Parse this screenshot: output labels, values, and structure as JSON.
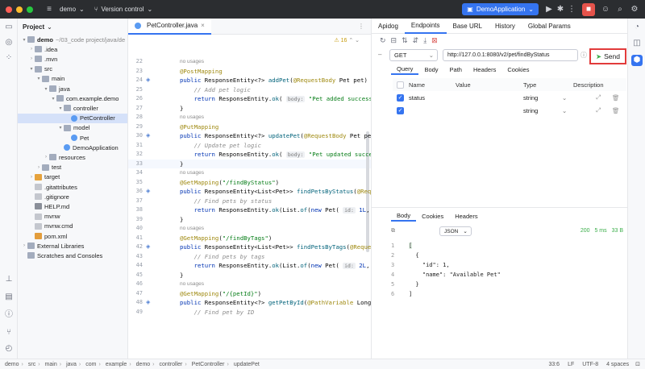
{
  "titlebar": {
    "project": "demo",
    "vcs": "Version control",
    "run_config": "DemoApplication"
  },
  "project_panel": {
    "title": "Project",
    "rows": [
      {
        "label": "demo",
        "suffix": "~/03_code project/java/de",
        "indent": 0,
        "type": "folder",
        "arrow": "▾"
      },
      {
        "label": ".idea",
        "indent": 1,
        "type": "folder",
        "arrow": "›"
      },
      {
        "label": ".mvn",
        "indent": 1,
        "type": "folder",
        "arrow": "›"
      },
      {
        "label": "src",
        "indent": 1,
        "type": "folder",
        "arrow": "▾"
      },
      {
        "label": "main",
        "indent": 2,
        "type": "folder",
        "arrow": "▾"
      },
      {
        "label": "java",
        "indent": 3,
        "type": "folder",
        "arrow": "▾"
      },
      {
        "label": "com.example.demo",
        "indent": 4,
        "type": "folder",
        "arrow": "▾"
      },
      {
        "label": "controller",
        "indent": 5,
        "type": "folder",
        "arrow": "▾"
      },
      {
        "label": "PetController",
        "indent": 6,
        "type": "java",
        "arrow": "",
        "selected": true
      },
      {
        "label": "model",
        "indent": 5,
        "type": "folder",
        "arrow": "▾"
      },
      {
        "label": "Pet",
        "indent": 6,
        "type": "java",
        "arrow": ""
      },
      {
        "label": "DemoApplication",
        "indent": 5,
        "type": "java",
        "arrow": ""
      },
      {
        "label": "resources",
        "indent": 3,
        "type": "folder",
        "arrow": "›"
      },
      {
        "label": "test",
        "indent": 2,
        "type": "folder",
        "arrow": "›"
      },
      {
        "label": "target",
        "indent": 1,
        "type": "folderorange",
        "arrow": "›"
      },
      {
        "label": ".gitattributes",
        "indent": 1,
        "type": "file",
        "arrow": ""
      },
      {
        "label": ".gitignore",
        "indent": 1,
        "type": "file",
        "arrow": ""
      },
      {
        "label": "HELP.md",
        "indent": 1,
        "type": "md",
        "arrow": ""
      },
      {
        "label": "mvnw",
        "indent": 1,
        "type": "file",
        "arrow": ""
      },
      {
        "label": "mvnw.cmd",
        "indent": 1,
        "type": "file",
        "arrow": ""
      },
      {
        "label": "pom.xml",
        "indent": 1,
        "type": "xml",
        "arrow": ""
      },
      {
        "label": "External Libraries",
        "indent": 0,
        "type": "lib",
        "arrow": "›"
      },
      {
        "label": "Scratches and Consoles",
        "indent": 0,
        "type": "lib",
        "arrow": ""
      }
    ]
  },
  "editor": {
    "tab": "PetController.java",
    "warnings": "⚠ 16",
    "lines": [
      {
        "n": "22",
        "html": "",
        "usage": "no usages"
      },
      {
        "n": "23",
        "parts": [
          [
            "an",
            "@PostMapping"
          ]
        ]
      },
      {
        "n": "24",
        "parts": [
          [
            "kw",
            "public "
          ],
          [
            "",
            "ResponseEntity<?> "
          ],
          [
            "fn",
            "addPet"
          ],
          [
            "",
            "("
          ],
          [
            "an",
            "@RequestBody "
          ],
          [
            "",
            "Pet pet) {"
          ]
        ],
        "mark": true
      },
      {
        "n": "25",
        "parts": [
          [
            "cm",
            "    // Add pet logic"
          ]
        ]
      },
      {
        "n": "26",
        "parts": [
          [
            "kw",
            "    return "
          ],
          [
            "",
            "ResponseEntity."
          ],
          [
            "fn",
            "ok"
          ],
          [
            "",
            "( "
          ],
          [
            "hint",
            "body:"
          ],
          [
            "st",
            " \"Pet added successfull"
          ]
        ]
      },
      {
        "n": "27",
        "parts": [
          [
            "",
            "}"
          ]
        ]
      },
      {
        "n": "28",
        "parts": [],
        "usage": "no usages"
      },
      {
        "n": "29",
        "parts": [
          [
            "an",
            "@PutMapping"
          ]
        ]
      },
      {
        "n": "30",
        "parts": [
          [
            "kw",
            "public "
          ],
          [
            "",
            "ResponseEntity<?> "
          ],
          [
            "fn",
            "updatePet"
          ],
          [
            "",
            "("
          ],
          [
            "an",
            "@RequestBody "
          ],
          [
            "",
            "Pet pet) {"
          ]
        ],
        "mark": true
      },
      {
        "n": "31",
        "parts": [
          [
            "cm",
            "    // Update pet logic"
          ]
        ]
      },
      {
        "n": "32",
        "parts": [
          [
            "kw",
            "    return "
          ],
          [
            "",
            "ResponseEntity."
          ],
          [
            "fn",
            "ok"
          ],
          [
            "",
            "( "
          ],
          [
            "hint",
            "body:"
          ],
          [
            "st",
            " \"Pet updated successfu"
          ]
        ]
      },
      {
        "n": "33",
        "parts": [
          [
            "",
            "}"
          ]
        ]
      },
      {
        "n": "34",
        "parts": [],
        "usage": "no usages"
      },
      {
        "n": "35",
        "parts": [
          [
            "an",
            "@GetMapping"
          ],
          [
            "",
            "("
          ],
          [
            "st",
            "\"/findByStatus\""
          ],
          [
            "",
            ")"
          ]
        ]
      },
      {
        "n": "36",
        "parts": [
          [
            "kw",
            "public "
          ],
          [
            "",
            "ResponseEntity<List<Pet>> "
          ],
          [
            "fn",
            "findPetsByStatus"
          ],
          [
            "",
            "("
          ],
          [
            "an",
            "@Reque"
          ]
        ],
        "mark": true
      },
      {
        "n": "37",
        "parts": [
          [
            "cm",
            "    // Find pets by status"
          ]
        ]
      },
      {
        "n": "38",
        "parts": [
          [
            "kw",
            "    return "
          ],
          [
            "",
            "ResponseEntity."
          ],
          [
            "fn",
            "ok"
          ],
          [
            "",
            "(List."
          ],
          [
            "fn",
            "of"
          ],
          [
            "",
            "("
          ],
          [
            "kw",
            "new "
          ],
          [
            "",
            "Pet( "
          ],
          [
            "hint",
            "id:"
          ],
          [
            "kw",
            " 1L"
          ],
          [
            "",
            ",  "
          ],
          [
            "hint",
            "nam"
          ]
        ]
      },
      {
        "n": "39",
        "parts": [
          [
            "",
            "}"
          ]
        ]
      },
      {
        "n": "40",
        "parts": [],
        "usage": "no usages"
      },
      {
        "n": "41",
        "parts": [
          [
            "an",
            "@GetMapping"
          ],
          [
            "",
            "("
          ],
          [
            "st",
            "\"/findByTags\""
          ],
          [
            "",
            ")"
          ]
        ]
      },
      {
        "n": "42",
        "parts": [
          [
            "kw",
            "public "
          ],
          [
            "",
            "ResponseEntity<List<Pet>> "
          ],
          [
            "fn",
            "findPetsByTags"
          ],
          [
            "",
            "("
          ],
          [
            "an",
            "@Requestl"
          ]
        ],
        "mark": true
      },
      {
        "n": "43",
        "parts": [
          [
            "cm",
            "    // Find pets by tags"
          ]
        ]
      },
      {
        "n": "44",
        "parts": [
          [
            "kw",
            "    return "
          ],
          [
            "",
            "ResponseEntity."
          ],
          [
            "fn",
            "ok"
          ],
          [
            "",
            "(List."
          ],
          [
            "fn",
            "of"
          ],
          [
            "",
            "("
          ],
          [
            "kw",
            "new "
          ],
          [
            "",
            "Pet( "
          ],
          [
            "hint",
            "id:"
          ],
          [
            "kw",
            " 2L"
          ],
          [
            "",
            ",  "
          ],
          [
            "hint",
            "nam"
          ]
        ]
      },
      {
        "n": "45",
        "parts": [
          [
            "",
            "}"
          ]
        ]
      },
      {
        "n": "46",
        "parts": [],
        "usage": "no usages"
      },
      {
        "n": "47",
        "parts": [
          [
            "an",
            "@GetMapping"
          ],
          [
            "",
            "("
          ],
          [
            "st",
            "\"/{petId}\""
          ],
          [
            "",
            ")"
          ]
        ]
      },
      {
        "n": "48",
        "parts": [
          [
            "kw",
            "public "
          ],
          [
            "",
            "ResponseEntity<?> "
          ],
          [
            "fn",
            "getPetById"
          ],
          [
            "",
            "("
          ],
          [
            "an",
            "@PathVariable "
          ],
          [
            "",
            "Long p"
          ]
        ],
        "mark": true
      },
      {
        "n": "49",
        "parts": [
          [
            "cm",
            "    // Find pet by ID"
          ]
        ]
      }
    ]
  },
  "apidog": {
    "tabs": [
      "Apidog",
      "Endpoints",
      "Base URL",
      "History",
      "Global Params"
    ],
    "active_tab": "Endpoints",
    "method": "GET",
    "url": "http://127.0.0.1:8080/v2/pet/findByStatus",
    "send": "Send",
    "req_tabs": [
      "Query",
      "Body",
      "Path",
      "Headers",
      "Cookies"
    ],
    "param_headers": [
      "Name",
      "Value",
      "Type",
      "Description"
    ],
    "params": [
      {
        "name": "status",
        "value": "",
        "type": "string"
      },
      {
        "name": "",
        "value": "",
        "type": "string"
      }
    ],
    "resp_tabs": [
      "Body",
      "Cookies",
      "Headers"
    ],
    "resp_format": "JSON",
    "resp_status": "200",
    "resp_time": "5 ms",
    "resp_size": "33 B",
    "resp_lines": [
      "[",
      "  {",
      "    \"id\": 1,",
      "    \"name\": \"Available Pet\"",
      "  }",
      "]"
    ]
  },
  "statusbar": {
    "crumbs": [
      "demo",
      "src",
      "main",
      "java",
      "com",
      "example",
      "demo",
      "controller",
      "PetController",
      "updatePet"
    ],
    "position": "33:6",
    "line_sep": "LF",
    "encoding": "UTF-8",
    "indent": "4 spaces"
  },
  "colors": {
    "accent": "#3574f0",
    "send_border": "#e23b3b"
  }
}
